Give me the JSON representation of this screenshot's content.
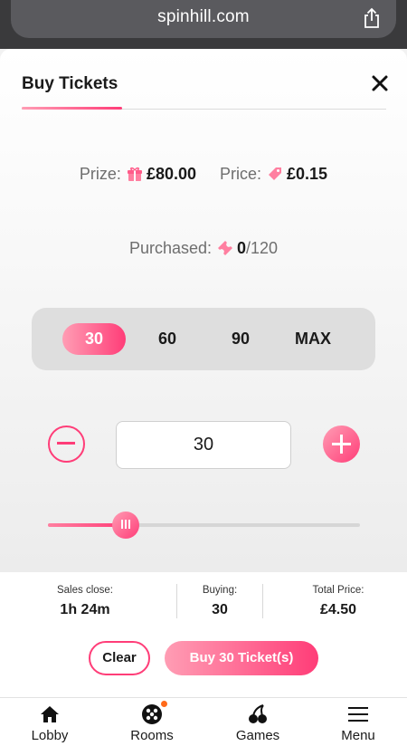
{
  "browser": {
    "url": "spinhill.com",
    "share_icon": "share-icon"
  },
  "modal": {
    "title": "Buy Tickets",
    "close_icon": "close-icon",
    "prize_label": "Prize:",
    "prize_value": "£80.00",
    "price_label": "Price:",
    "price_value": "£0.15",
    "purchased_label": "Purchased:",
    "purchased_count": "0",
    "purchased_total": "/120"
  },
  "presets": [
    {
      "label": "30",
      "active": true
    },
    {
      "label": "60",
      "active": false
    },
    {
      "label": "90",
      "active": false
    },
    {
      "label": "MAX",
      "active": false
    }
  ],
  "stepper": {
    "value": "30"
  },
  "slider": {
    "fraction": 0.25
  },
  "summary": {
    "sales_close_label": "Sales close:",
    "sales_close_value": "1h 24m",
    "buying_label": "Buying:",
    "buying_value": "30",
    "total_label": "Total Price:",
    "total_value": "£4.50",
    "clear_label": "Clear",
    "buy_label": "Buy 30 Ticket(s)"
  },
  "nav": [
    {
      "label": "Lobby",
      "icon": "home-icon"
    },
    {
      "label": "Rooms",
      "icon": "bingo-ball-icon",
      "badge": true
    },
    {
      "label": "Games",
      "icon": "cherries-icon"
    },
    {
      "label": "Menu",
      "icon": "hamburger-icon"
    }
  ],
  "colors": {
    "accent": "#ff3d78",
    "accent_light": "#ff9db4",
    "badge": "#ff6a1a"
  }
}
